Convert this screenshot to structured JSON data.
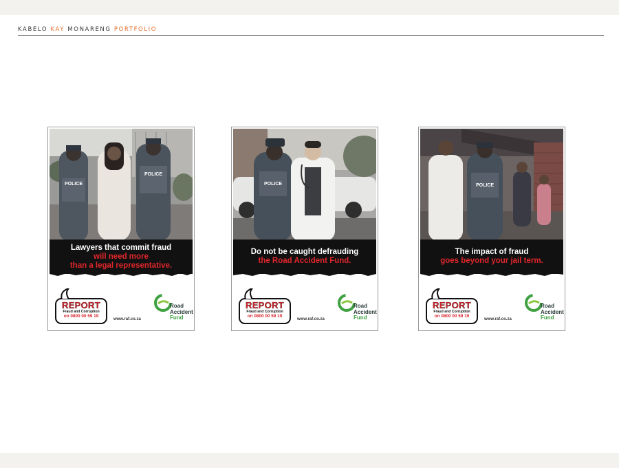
{
  "header": {
    "name_part1": "KABELO ",
    "name_accent": "KAY",
    "name_part2": " MONARENG ",
    "portfolio": "PORTFOLIO"
  },
  "colors": {
    "accent": "#e36f2b",
    "report_red": "#d8232a",
    "raf_green": "#3fa142"
  },
  "posters": [
    {
      "line1": "Lawyers that commit fraud",
      "line2": "will need more",
      "line3": "than a legal representative.",
      "police_label": "POLICE",
      "report_title": "REPORT",
      "report_sub": "Fraud and Corruption",
      "report_phone": "on 0800 00 59 19",
      "url": "www.raf.co.za",
      "raf_line1": "Road",
      "raf_line2": "Accident",
      "raf_line3": "Fund"
    },
    {
      "line1": "Do not be caught defrauding",
      "line2": "the Road Accident Fund.",
      "police_label": "POLICE",
      "report_title": "REPORT",
      "report_sub": "Fraud and Corruption",
      "report_phone": "on 0800 00 59 19",
      "url": "www.raf.co.za",
      "raf_line1": "Road",
      "raf_line2": "Accident",
      "raf_line3": "Fund"
    },
    {
      "line1": "The impact of fraud",
      "line2": "goes beyond your jail term.",
      "police_label": "POLICE",
      "report_title": "REPORT",
      "report_sub": "Fraud and Corruption",
      "report_phone": "on 0800 00 59 19",
      "url": "www.raf.co.za",
      "raf_line1": "Road",
      "raf_line2": "Accident",
      "raf_line3": "Fund"
    }
  ]
}
